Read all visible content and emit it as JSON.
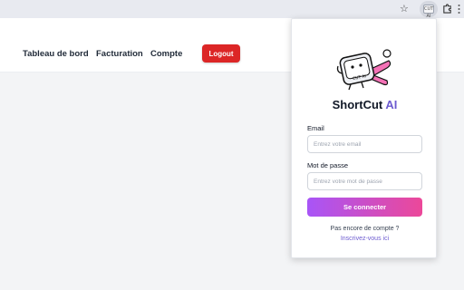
{
  "browser": {
    "star_icon": "star-icon",
    "extension_badge": "CUT AI",
    "puzzle_icon": "puzzle-icon",
    "menu_icon": "kebab-menu-icon"
  },
  "nav": {
    "items": [
      {
        "label": "Tableau de bord"
      },
      {
        "label": "Facturation"
      },
      {
        "label": "Compte"
      }
    ],
    "logout_label": "Logout"
  },
  "popup": {
    "brand_name": "ShortCut",
    "brand_suffix": "AI",
    "logo_text": "CUT AI",
    "email": {
      "label": "Email",
      "placeholder": "Entrez votre email",
      "value": ""
    },
    "password": {
      "label": "Mot de passe",
      "placeholder": "Entrez votre mot de passe",
      "value": ""
    },
    "submit_label": "Se connecter",
    "no_account_text": "Pas encore de compte ?",
    "signup_link": "Inscrivez-vous ici"
  },
  "colors": {
    "logout_bg": "#dc2626",
    "accent": "#6d5bd0",
    "gradient_start": "#a855f7",
    "gradient_end": "#ec4899"
  }
}
